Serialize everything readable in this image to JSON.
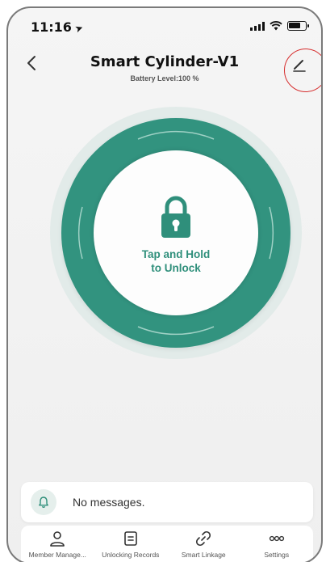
{
  "status_bar": {
    "time": "11:16"
  },
  "header": {
    "title": "Smart Cylinder-V1",
    "battery_text": "Battery Level:100 %"
  },
  "lock": {
    "action_label": "Tap and Hold\nto Unlock"
  },
  "messages": {
    "text": "No messages."
  },
  "tabs": [
    {
      "label": "Member Manage...",
      "icon": "person-icon"
    },
    {
      "label": "Unlocking Records",
      "icon": "records-icon"
    },
    {
      "label": "Smart Linkage",
      "icon": "link-icon"
    },
    {
      "label": "Settings",
      "icon": "more-dots-icon"
    }
  ],
  "colors": {
    "accent": "#32937f",
    "accent_text": "#2f8f7b",
    "annotation": "#d62d2d"
  }
}
